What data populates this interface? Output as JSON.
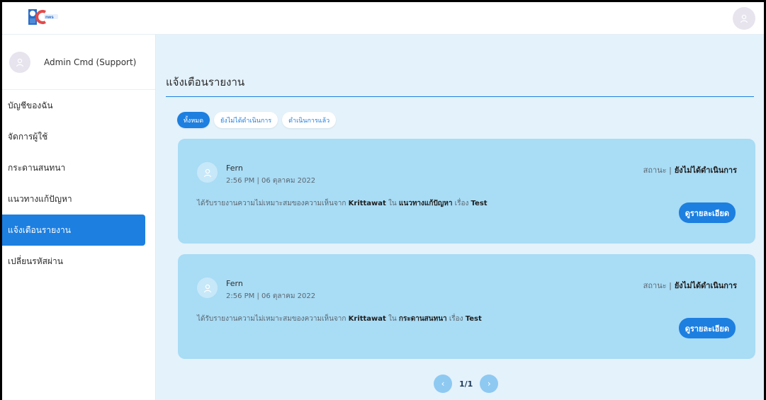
{
  "sidebar": {
    "user_name": "Admin Cmd (Support)",
    "items": [
      {
        "label": "บัญชีของฉัน"
      },
      {
        "label": "จัดการผู้ใช้"
      },
      {
        "label": "กระดานสนทนา"
      },
      {
        "label": "แนวทางแก้ปัญหา"
      },
      {
        "label": "แจ้งเตือนรายงาน"
      },
      {
        "label": "เปลี่ยนรหัสผ่าน"
      }
    ]
  },
  "main": {
    "title": "แจ้งเตือนรายงาน",
    "filters": [
      {
        "label": "ทั้งหมด"
      },
      {
        "label": "ยังไม่ได้ดำเนินการ"
      },
      {
        "label": "ดำเนินการแล้ว"
      }
    ],
    "reports": [
      {
        "name": "Fern",
        "time": "2:56 PM | 06 ตุลาคม 2022",
        "status_label": "สถานะ |",
        "status_value": "ยังไม่ได้ดำเนินการ",
        "msg_prefix": "ได้รับรายงานความไม่เหมาะสมของความเห็นจาก",
        "reporter": "Krittawat",
        "in": "ใน",
        "section": "แนวทางแก้ปัญหา",
        "subject_label": "เรื่อง",
        "subject": "Test",
        "button": "ดูรายละเอียด"
      },
      {
        "name": "Fern",
        "time": "2:56 PM | 06 ตุลาคม 2022",
        "status_label": "สถานะ |",
        "status_value": "ยังไม่ได้ดำเนินการ",
        "msg_prefix": "ได้รับรายงานความไม่เหมาะสมของความเห็นจาก",
        "reporter": "Krittawat",
        "in": "ใน",
        "section": "กระดานสนทนา",
        "subject_label": "เรื่อง",
        "subject": "Test",
        "button": "ดูรายละเอียด"
      }
    ],
    "pagination": {
      "text": "1/1"
    }
  },
  "colors": {
    "accent": "#1d7fe0",
    "card": "#a9dcf5",
    "background": "#e4f2fb"
  }
}
